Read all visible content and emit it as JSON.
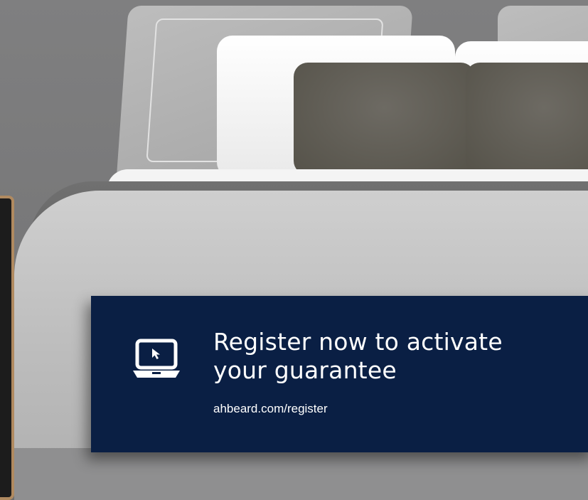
{
  "banner": {
    "headline_line1": "Register now to activate",
    "headline_line2": "your guarantee",
    "url": "ahbeard.com/register",
    "icon": "laptop-cursor-icon",
    "background_color": "#0a1f44",
    "text_color": "#ffffff"
  }
}
